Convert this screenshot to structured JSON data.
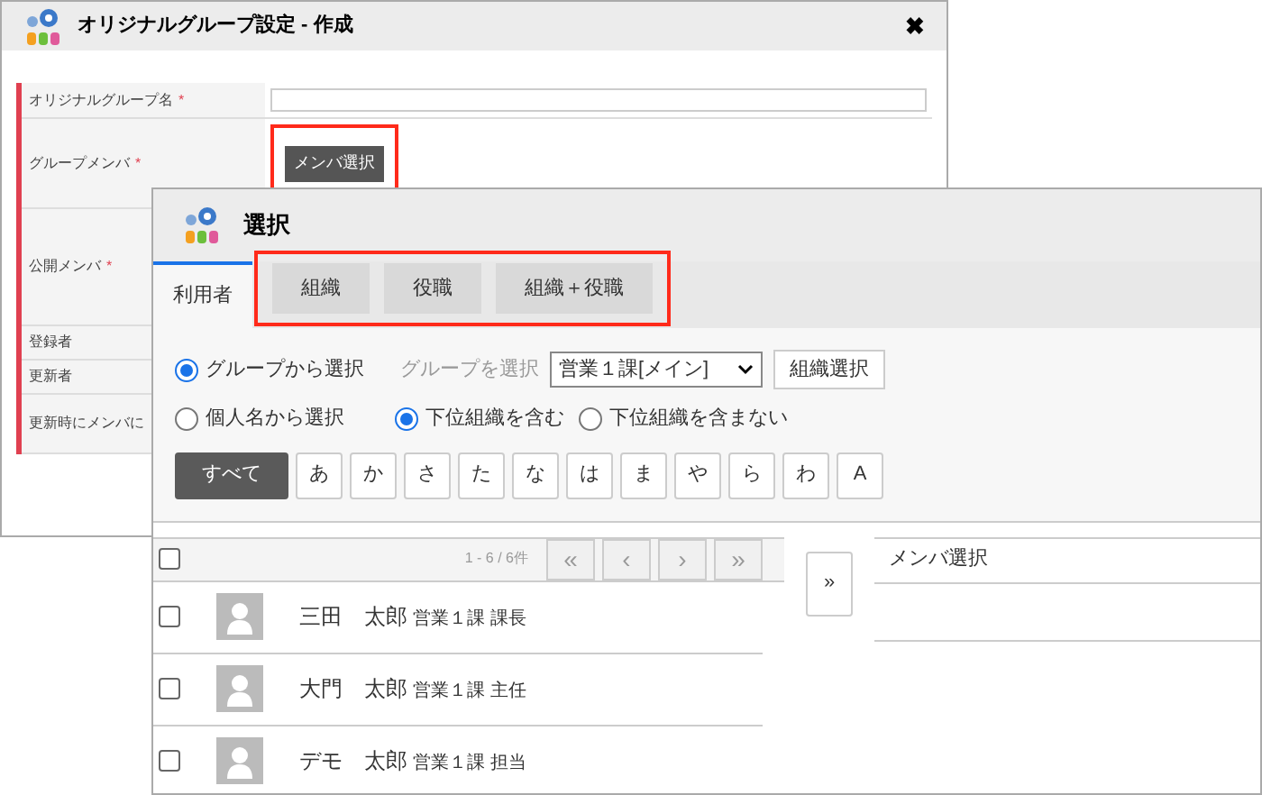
{
  "back_window": {
    "title": "オリジナルグループ設定 - 作成",
    "close": "✖",
    "fields": [
      {
        "label": "オリジナルグループ名",
        "required_mark": "*",
        "kind": "text"
      },
      {
        "label": "グループメンバ",
        "required_mark": "*",
        "kind": "button",
        "button": "メンバ選択",
        "highlighted": true
      },
      {
        "label": "公開メンバ",
        "required_mark": "*",
        "kind": "empty"
      },
      {
        "label": "登録者",
        "kind": "empty"
      },
      {
        "label": "更新者",
        "kind": "empty"
      },
      {
        "label": "更新時にメンバに",
        "kind": "empty"
      }
    ]
  },
  "dialog": {
    "title": "選択",
    "tabs": [
      {
        "label": "利用者",
        "selected": true
      },
      {
        "label": "組織",
        "selected": false
      },
      {
        "label": "役職",
        "selected": false
      },
      {
        "label": "組織＋役職",
        "selected": false
      }
    ],
    "source_options": [
      {
        "label": "グループから選択",
        "selected": true
      },
      {
        "label": "個人名から選択",
        "selected": false
      }
    ],
    "group_label": "グループを選択",
    "group_select": "営業１課[メイン]",
    "group_button": "組織選択",
    "scope_options": [
      {
        "label": "下位組織を含む",
        "selected": true
      },
      {
        "label": "下位組織を含まない",
        "selected": false
      }
    ],
    "letters": [
      {
        "label": "すべて",
        "selected": true
      },
      {
        "label": "あ",
        "selected": false
      },
      {
        "label": "か",
        "selected": false
      },
      {
        "label": "さ",
        "selected": false
      },
      {
        "label": "た",
        "selected": false
      },
      {
        "label": "な",
        "selected": false
      },
      {
        "label": "は",
        "selected": false
      },
      {
        "label": "ま",
        "selected": false
      },
      {
        "label": "や",
        "selected": false
      },
      {
        "label": "ら",
        "selected": false
      },
      {
        "label": "わ",
        "selected": false
      },
      {
        "label": "A",
        "selected": false
      }
    ],
    "list": {
      "all_checked": false,
      "count": "1 - 6 / 6件",
      "pager": [
        "«",
        "‹",
        "›",
        "»"
      ],
      "rows": [
        {
          "name": "三田　太郎",
          "detail": "営業１課 課長",
          "checked": false
        },
        {
          "name": "大門　太郎",
          "detail": "営業１課 主任",
          "checked": false
        },
        {
          "name": "デモ　太郎",
          "detail": "営業１課 担当",
          "checked": false
        }
      ]
    },
    "move_button": "»",
    "selected_header": "メンバ選択"
  }
}
